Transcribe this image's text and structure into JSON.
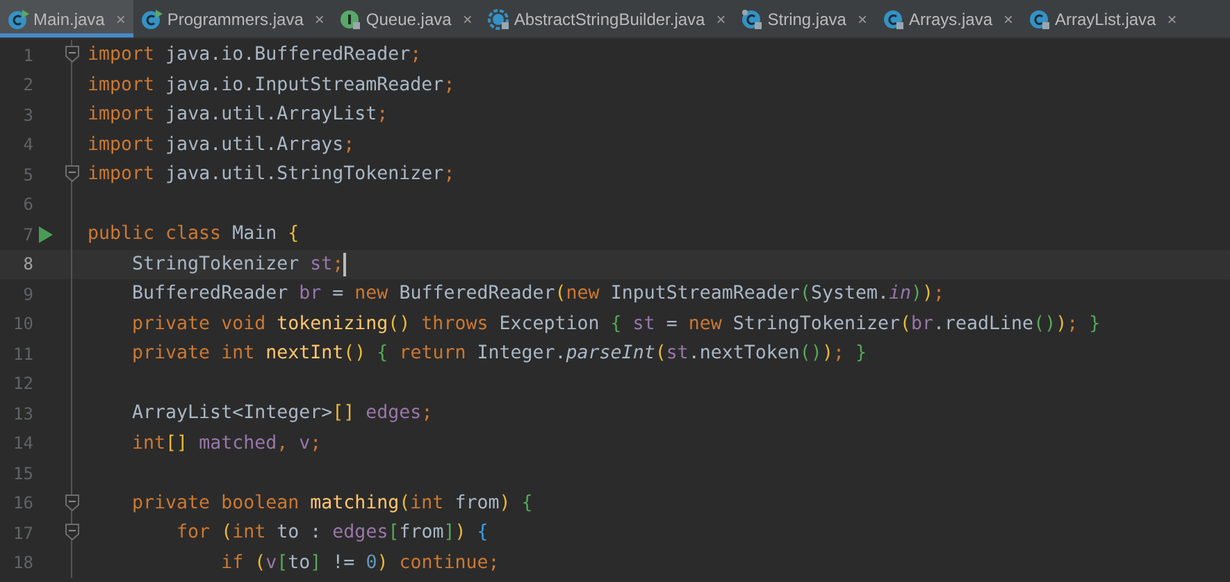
{
  "tabs": [
    {
      "label": "Main.java",
      "kind": "class_run",
      "close": "×",
      "selected": true
    },
    {
      "label": "Programmers.java",
      "kind": "class_run",
      "close": "×",
      "selected": false
    },
    {
      "label": "Queue.java",
      "kind": "interface_locked",
      "close": "×",
      "selected": false
    },
    {
      "label": "AbstractStringBuilder.java",
      "kind": "abstract_locked",
      "close": "×",
      "selected": false
    },
    {
      "label": "String.java",
      "kind": "class_locked_pinned",
      "close": "×",
      "selected": false
    },
    {
      "label": "Arrays.java",
      "kind": "class_locked",
      "close": "×",
      "selected": false
    },
    {
      "label": "ArrayList.java",
      "kind": "class_locked",
      "close": "×",
      "selected": false
    }
  ],
  "editor": {
    "lines": [
      {
        "number": "1",
        "fold": true,
        "run": false,
        "current": false,
        "tokens": [
          {
            "text": "import",
            "kind": "keyword"
          },
          {
            "text": " java.io.BufferedReader",
            "kind": "plain"
          },
          {
            "text": ";",
            "kind": "keyword"
          }
        ]
      },
      {
        "number": "2",
        "fold": false,
        "run": false,
        "current": false,
        "tokens": [
          {
            "text": "import",
            "kind": "keyword"
          },
          {
            "text": " java.io.InputStreamReader",
            "kind": "plain"
          },
          {
            "text": ";",
            "kind": "keyword"
          }
        ]
      },
      {
        "number": "3",
        "fold": false,
        "run": false,
        "current": false,
        "tokens": [
          {
            "text": "import",
            "kind": "keyword"
          },
          {
            "text": " java.util.ArrayList",
            "kind": "plain"
          },
          {
            "text": ";",
            "kind": "keyword"
          }
        ]
      },
      {
        "number": "4",
        "fold": false,
        "run": false,
        "current": false,
        "tokens": [
          {
            "text": "import",
            "kind": "keyword"
          },
          {
            "text": " java.util.Arrays",
            "kind": "plain"
          },
          {
            "text": ";",
            "kind": "keyword"
          }
        ]
      },
      {
        "number": "5",
        "fold": true,
        "run": false,
        "current": false,
        "tokens": [
          {
            "text": "import",
            "kind": "keyword"
          },
          {
            "text": " java.util.StringTokenizer",
            "kind": "plain"
          },
          {
            "text": ";",
            "kind": "keyword"
          }
        ]
      },
      {
        "number": "6",
        "fold": false,
        "run": false,
        "current": false
      },
      {
        "number": "7",
        "fold": false,
        "run": true,
        "current": false,
        "tokens": [
          {
            "text": "public class",
            "kind": "keyword"
          },
          {
            "text": " Main ",
            "kind": "plain"
          },
          {
            "text": "{",
            "kind": "bracket1"
          }
        ]
      },
      {
        "number": "8",
        "fold": false,
        "run": false,
        "current": true,
        "tokens": [
          {
            "text": "    StringTokenizer ",
            "kind": "plain"
          },
          {
            "text": "st",
            "kind": "field"
          },
          {
            "text": ";",
            "kind": "keyword"
          }
        ]
      },
      {
        "number": "9",
        "fold": false,
        "run": false,
        "current": false,
        "tokens": [
          {
            "text": "    BufferedReader ",
            "kind": "plain"
          },
          {
            "text": "br",
            "kind": "field"
          },
          {
            "text": " = ",
            "kind": "plain"
          },
          {
            "text": "new",
            "kind": "keyword"
          },
          {
            "text": " BufferedReader",
            "kind": "plain"
          },
          {
            "text": "(",
            "kind": "bracket1"
          },
          {
            "text": "new",
            "kind": "keyword"
          },
          {
            "text": " InputStreamReader",
            "kind": "plain"
          },
          {
            "text": "(",
            "kind": "bracket2"
          },
          {
            "text": "System.",
            "kind": "plain"
          },
          {
            "text": "in",
            "kind": "static_field"
          },
          {
            "text": ")",
            "kind": "bracket2"
          },
          {
            "text": ")",
            "kind": "bracket1"
          },
          {
            "text": ";",
            "kind": "keyword"
          }
        ]
      },
      {
        "number": "10",
        "fold": false,
        "run": false,
        "current": false,
        "tokens": [
          {
            "text": "    private void ",
            "kind": "keyword"
          },
          {
            "text": "tokenizing",
            "kind": "method"
          },
          {
            "text": "()",
            "kind": "bracket1"
          },
          {
            "text": " throws ",
            "kind": "keyword"
          },
          {
            "text": "Exception ",
            "kind": "plain"
          },
          {
            "text": "{",
            "kind": "bracket2"
          },
          {
            "text": " st",
            "kind": "field"
          },
          {
            "text": " = ",
            "kind": "plain"
          },
          {
            "text": "new",
            "kind": "keyword"
          },
          {
            "text": " StringTokenizer",
            "kind": "plain"
          },
          {
            "text": "(",
            "kind": "bracket1"
          },
          {
            "text": "br",
            "kind": "field"
          },
          {
            "text": ".readLine",
            "kind": "plain"
          },
          {
            "text": "()",
            "kind": "bracket2"
          },
          {
            "text": ")",
            "kind": "bracket1"
          },
          {
            "text": "; ",
            "kind": "keyword"
          },
          {
            "text": "}",
            "kind": "bracket2"
          }
        ]
      },
      {
        "number": "11",
        "fold": false,
        "run": false,
        "current": false,
        "tokens": [
          {
            "text": "    private int ",
            "kind": "keyword"
          },
          {
            "text": "nextInt",
            "kind": "method"
          },
          {
            "text": "() ",
            "kind": "bracket1"
          },
          {
            "text": "{",
            "kind": "bracket2"
          },
          {
            "text": " return ",
            "kind": "keyword"
          },
          {
            "text": "Integer.",
            "kind": "plain"
          },
          {
            "text": "parseInt",
            "kind": "static_method"
          },
          {
            "text": "(",
            "kind": "bracket1"
          },
          {
            "text": "st",
            "kind": "field"
          },
          {
            "text": ".nextToken",
            "kind": "plain"
          },
          {
            "text": "()",
            "kind": "bracket2"
          },
          {
            "text": ")",
            "kind": "bracket1"
          },
          {
            "text": "; ",
            "kind": "keyword"
          },
          {
            "text": "}",
            "kind": "bracket2"
          }
        ]
      },
      {
        "number": "12",
        "fold": false,
        "run": false,
        "current": false
      },
      {
        "number": "13",
        "fold": false,
        "run": false,
        "current": false,
        "tokens": [
          {
            "text": "    ArrayList<Integer>",
            "kind": "plain"
          },
          {
            "text": "[]",
            "kind": "bracket1"
          },
          {
            "text": " edges",
            "kind": "field"
          },
          {
            "text": ";",
            "kind": "keyword"
          }
        ]
      },
      {
        "number": "14",
        "fold": false,
        "run": false,
        "current": false,
        "tokens": [
          {
            "text": "    int",
            "kind": "keyword"
          },
          {
            "text": "[]",
            "kind": "bracket1"
          },
          {
            "text": " matched",
            "kind": "field"
          },
          {
            "text": ", ",
            "kind": "keyword"
          },
          {
            "text": "v",
            "kind": "field"
          },
          {
            "text": ";",
            "kind": "keyword"
          }
        ]
      },
      {
        "number": "15",
        "fold": false,
        "run": false,
        "current": false
      },
      {
        "number": "16",
        "fold": true,
        "run": false,
        "current": false,
        "tokens": [
          {
            "text": "    private boolean ",
            "kind": "keyword"
          },
          {
            "text": "matching",
            "kind": "method"
          },
          {
            "text": "(",
            "kind": "bracket1"
          },
          {
            "text": "int",
            "kind": "keyword"
          },
          {
            "text": " from",
            "kind": "plain"
          },
          {
            "text": ") ",
            "kind": "bracket1"
          },
          {
            "text": "{",
            "kind": "bracket2"
          }
        ]
      },
      {
        "number": "17",
        "fold": true,
        "run": false,
        "current": false,
        "tokens": [
          {
            "text": "        for ",
            "kind": "keyword"
          },
          {
            "text": "(",
            "kind": "bracket1"
          },
          {
            "text": "int",
            "kind": "keyword"
          },
          {
            "text": " to : ",
            "kind": "plain"
          },
          {
            "text": "edges",
            "kind": "field"
          },
          {
            "text": "[",
            "kind": "bracket2"
          },
          {
            "text": "from",
            "kind": "plain"
          },
          {
            "text": "]",
            "kind": "bracket2"
          },
          {
            "text": ") ",
            "kind": "bracket1"
          },
          {
            "text": "{",
            "kind": "bracket3"
          }
        ]
      },
      {
        "number": "18",
        "fold": false,
        "run": false,
        "current": false,
        "tokens": [
          {
            "text": "            if ",
            "kind": "keyword"
          },
          {
            "text": "(",
            "kind": "bracket1"
          },
          {
            "text": "v",
            "kind": "field"
          },
          {
            "text": "[",
            "kind": "bracket2"
          },
          {
            "text": "to",
            "kind": "plain"
          },
          {
            "text": "]",
            "kind": "bracket2"
          },
          {
            "text": " != ",
            "kind": "plain"
          },
          {
            "text": "0",
            "kind": "number"
          },
          {
            "text": ")",
            "kind": "bracket1"
          },
          {
            "text": " continue",
            "kind": "keyword"
          },
          {
            "text": ";",
            "kind": "keyword"
          }
        ]
      }
    ]
  }
}
